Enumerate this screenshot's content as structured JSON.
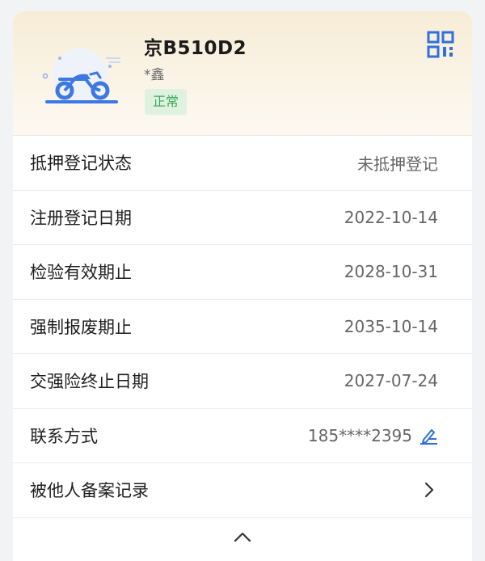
{
  "vehicle": {
    "plate": "京B510D2",
    "owner": "*鑫",
    "status": "正常"
  },
  "icons": {
    "qr": "qr-code-icon",
    "illustration": "motorcycle-icon",
    "edit": "edit-pen-icon",
    "chevron_right": "chevron-right-icon",
    "chevron_up": "chevron-up-icon"
  },
  "rows": [
    {
      "label": "抵押登记状态",
      "value": "未抵押登记"
    },
    {
      "label": "注册登记日期",
      "value": "2022-10-14"
    },
    {
      "label": "检验有效期止",
      "value": "2028-10-31"
    },
    {
      "label": "强制报废期止",
      "value": "2035-10-14"
    },
    {
      "label": "交强险终止日期",
      "value": "2027-07-24"
    },
    {
      "label": "联系方式",
      "value": "185****2395"
    },
    {
      "label": "被他人备案记录",
      "value": ""
    }
  ],
  "colors": {
    "accent": "#2f6fe0",
    "status_green": "#3aa85a",
    "status_bg": "#dff2df",
    "header_bg": "#f7ecd6"
  }
}
